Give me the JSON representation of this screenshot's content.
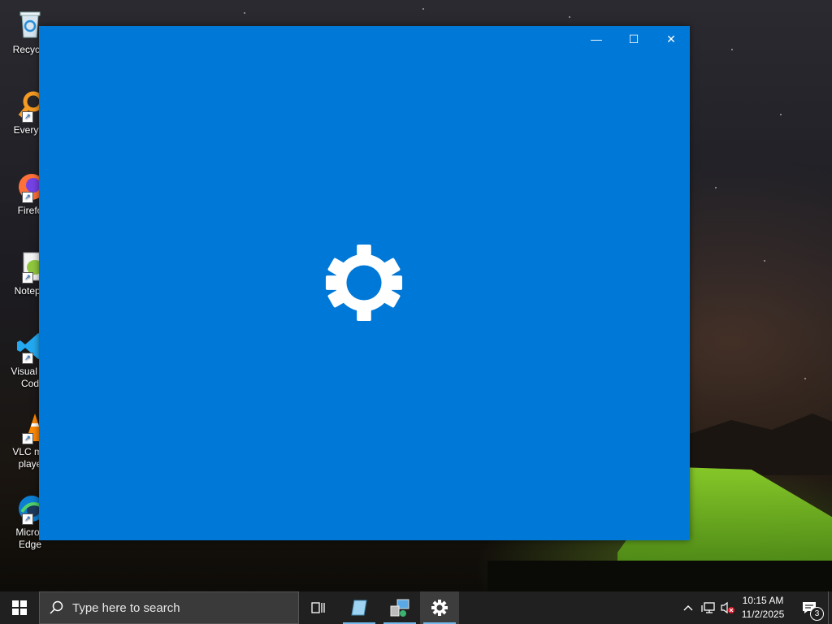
{
  "desktop": {
    "icons": [
      {
        "label": "Recycle"
      },
      {
        "label": "Everyth"
      },
      {
        "label": "Firefo"
      },
      {
        "label": "Notepa"
      },
      {
        "label": "Visual St\nCod"
      },
      {
        "label": "VLC me\nplaye"
      },
      {
        "label": "Micros\nEdge"
      }
    ]
  },
  "window": {
    "minimize_glyph": "—",
    "maximize_glyph": "☐",
    "close_glyph": "✕",
    "accent": "#0078d7",
    "center_icon": "gear-icon"
  },
  "taskbar": {
    "search_placeholder": "Type here to search",
    "clock_time": "10:15 AM",
    "clock_date": "11/2/2025",
    "notification_count": "3"
  }
}
